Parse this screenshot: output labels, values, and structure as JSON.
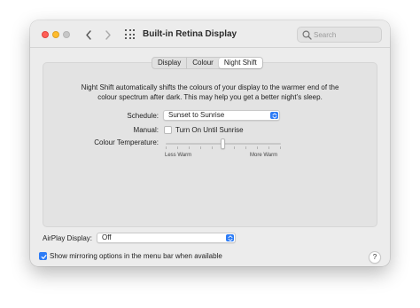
{
  "window": {
    "title": "Built-in Retina Display"
  },
  "search": {
    "placeholder": "Search"
  },
  "tabs": [
    {
      "label": "Display"
    },
    {
      "label": "Colour"
    },
    {
      "label": "Night Shift"
    }
  ],
  "active_tab": "Night Shift",
  "night_shift": {
    "description": "Night Shift automatically shifts the colours of your display to the warmer end of the colour spectrum after dark. This may help you get a better night’s sleep.",
    "schedule_label": "Schedule:",
    "schedule_value": "Sunset to Sunrise",
    "manual_label": "Manual:",
    "manual_checkbox_label": "Turn On Until Sunrise",
    "manual_checked": false,
    "temperature_label": "Colour Temperature:",
    "temperature_min_label": "Less Warm",
    "temperature_max_label": "More Warm",
    "temperature_value_fraction": 0.5
  },
  "airplay": {
    "label": "AirPlay Display:",
    "value": "Off"
  },
  "mirroring": {
    "label": "Show mirroring options in the menu bar when available",
    "checked": true
  },
  "help": {
    "label": "?"
  },
  "colors": {
    "accent": "#2d7cf6",
    "close": "#fe5f57",
    "minimize": "#febc2e",
    "zoom_disabled": "#c7c7c7"
  }
}
